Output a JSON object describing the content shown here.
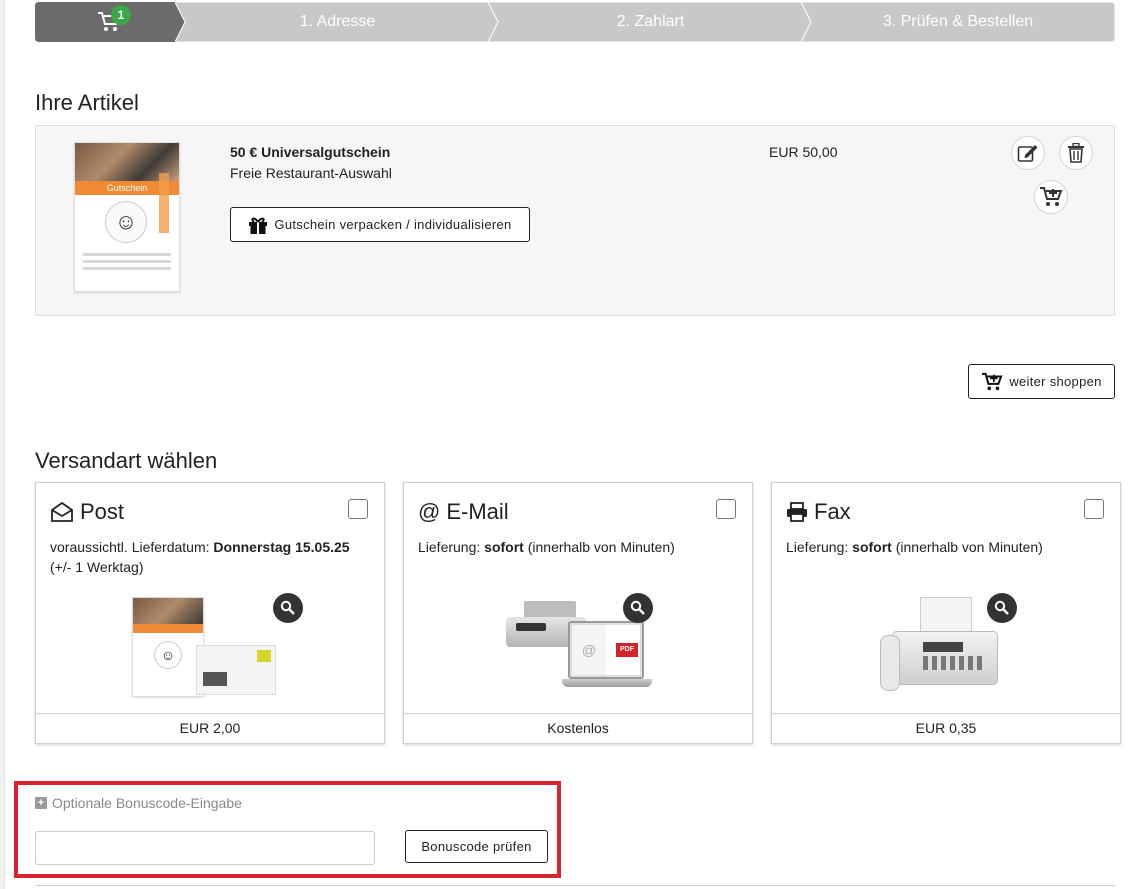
{
  "stepper": {
    "cart_badge": "1",
    "steps": [
      "1. Adresse",
      "2. Zahlart",
      "3. Prüfen & Bestellen"
    ],
    "active_color": "#6b6b6b",
    "inactive_color": "#c8c8c8"
  },
  "articles": {
    "heading": "Ihre Artikel",
    "item": {
      "thumb_band_text": "Gutschein",
      "title": "50 € Universalgutschein",
      "subtitle": "Freie Restaurant-Auswahl",
      "price": "EUR 50,00",
      "pack_button": "Gutschein verpacken / individualisieren",
      "icons": [
        "edit-icon",
        "trash-icon",
        "cart-add-icon"
      ]
    },
    "continue_button": "weiter shoppen"
  },
  "shipping": {
    "heading": "Versandart wählen",
    "options": [
      {
        "name": "Post",
        "icon": "envelope-open-icon",
        "desc_prefix": "voraussichtl. Lieferdatum: ",
        "desc_bold": "Donnerstag 15.05.25",
        "desc_suffix": "(+/- 1 Werktag)",
        "price": "EUR 2,00"
      },
      {
        "name": "E-Mail",
        "icon": "at-icon",
        "desc_prefix": "Lieferung: ",
        "desc_bold": "sofort",
        "desc_suffix": " (innerhalb von Minuten)",
        "price": "Kostenlos"
      },
      {
        "name": "Fax",
        "icon": "printer-icon",
        "desc_prefix": "Lieferung: ",
        "desc_bold": "sofort",
        "desc_suffix": " (innerhalb von Minuten)",
        "price": "EUR 0,35"
      }
    ]
  },
  "bonus": {
    "toggle_label": "Optionale Bonuscode-Eingabe",
    "input_value": "",
    "input_placeholder": "",
    "check_button": "Bonuscode prüfen",
    "highlight_color": "#d9232e"
  }
}
